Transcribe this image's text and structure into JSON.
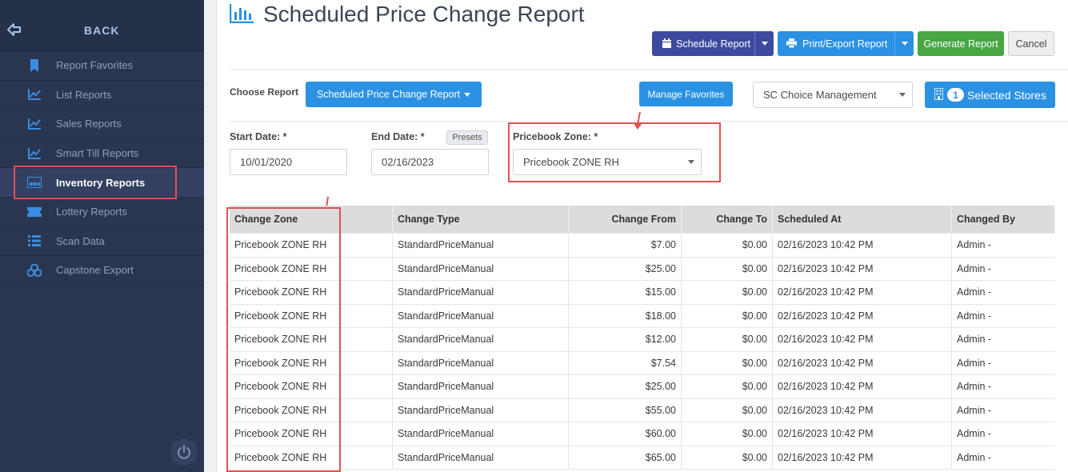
{
  "sidebar": {
    "back_label": "BACK",
    "items": [
      {
        "label": "Report Favorites",
        "icon": "bookmark-icon"
      },
      {
        "label": "List Reports",
        "icon": "chart-line-icon"
      },
      {
        "label": "Sales Reports",
        "icon": "chart-line-icon"
      },
      {
        "label": "Smart Till Reports",
        "icon": "chart-line-icon"
      },
      {
        "label": "Inventory Reports",
        "icon": "warehouse-icon"
      },
      {
        "label": "Lottery Reports",
        "icon": "ticket-icon"
      },
      {
        "label": "Scan Data",
        "icon": "list-icon"
      },
      {
        "label": "Capstone Export",
        "icon": "cubes-icon"
      }
    ],
    "active_item": "Inventory Reports"
  },
  "header": {
    "title": "Scheduled Price Change Report"
  },
  "toolbar": {
    "schedule_label": "Schedule Report",
    "print_label": "Print/Export Report",
    "generate_label": "Generate Report",
    "cancel_label": "Cancel"
  },
  "report_bar": {
    "choose_label": "Choose Report",
    "choose_value": "Scheduled Price Change Report",
    "manage_favorites_label": "Manage Favorites",
    "company_value": "SC Choice Management",
    "selected_stores_count": "1",
    "selected_stores_label": "Selected Stores"
  },
  "filters": {
    "start_label": "Start Date: *",
    "start_value": "10/01/2020",
    "end_label": "End Date: *",
    "end_value": "02/16/2023",
    "presets_label": "Presets",
    "zone_label": "Pricebook Zone: *",
    "zone_value": "Pricebook ZONE RH"
  },
  "table": {
    "headers": [
      "Change Zone",
      "Change Type",
      "Change From",
      "Change To",
      "Scheduled At",
      "Changed By"
    ],
    "rows": [
      [
        "Pricebook ZONE RH",
        "StandardPriceManual",
        "$7.00",
        "$0.00",
        "02/16/2023 10:42 PM",
        "Admin -"
      ],
      [
        "Pricebook ZONE RH",
        "StandardPriceManual",
        "$25.00",
        "$0.00",
        "02/16/2023 10:42 PM",
        "Admin -"
      ],
      [
        "Pricebook ZONE RH",
        "StandardPriceManual",
        "$15.00",
        "$0.00",
        "02/16/2023 10:42 PM",
        "Admin -"
      ],
      [
        "Pricebook ZONE RH",
        "StandardPriceManual",
        "$18.00",
        "$0.00",
        "02/16/2023 10:42 PM",
        "Admin -"
      ],
      [
        "Pricebook ZONE RH",
        "StandardPriceManual",
        "$12.00",
        "$0.00",
        "02/16/2023 10:42 PM",
        "Admin -"
      ],
      [
        "Pricebook ZONE RH",
        "StandardPriceManual",
        "$7.54",
        "$0.00",
        "02/16/2023 10:42 PM",
        "Admin -"
      ],
      [
        "Pricebook ZONE RH",
        "StandardPriceManual",
        "$25.00",
        "$0.00",
        "02/16/2023 10:42 PM",
        "Admin -"
      ],
      [
        "Pricebook ZONE RH",
        "StandardPriceManual",
        "$55.00",
        "$0.00",
        "02/16/2023 10:42 PM",
        "Admin -"
      ],
      [
        "Pricebook ZONE RH",
        "StandardPriceManual",
        "$60.00",
        "$0.00",
        "02/16/2023 10:42 PM",
        "Admin -"
      ],
      [
        "Pricebook ZONE RH",
        "StandardPriceManual",
        "$65.00",
        "$0.00",
        "02/16/2023 10:42 PM",
        "Admin -"
      ]
    ]
  },
  "colors": {
    "sidebar_bg": "#2a3550",
    "primary_blue": "#2a91e3",
    "schedule_indigo": "#3d4aa0",
    "generate_green": "#46a744",
    "annotation_red": "#e05252"
  }
}
